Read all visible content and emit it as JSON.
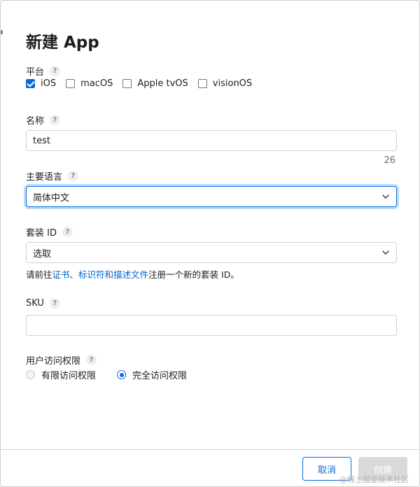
{
  "dialog": {
    "title": "新建 App"
  },
  "platform": {
    "label": "平台",
    "help": "?",
    "options": [
      {
        "label": "iOS",
        "checked": true
      },
      {
        "label": "macOS",
        "checked": false
      },
      {
        "label": "Apple tvOS",
        "checked": false
      },
      {
        "label": "visionOS",
        "checked": false
      }
    ]
  },
  "name": {
    "label": "名称",
    "help": "?",
    "value": "test",
    "remaining": "26"
  },
  "language": {
    "label": "主要语言",
    "help": "?",
    "selected": "简体中文"
  },
  "bundle": {
    "label": "套装 ID",
    "help": "?",
    "selected": "选取",
    "hint_prefix": "请前往",
    "hint_link": "证书、标识符和描述文件",
    "hint_suffix": "注册一个新的套装 ID。"
  },
  "sku": {
    "label": "SKU",
    "help": "?",
    "value": ""
  },
  "access": {
    "label": "用户访问权限",
    "help": "?",
    "options": [
      {
        "label": "有限访问权限",
        "selected": false
      },
      {
        "label": "完全访问权限",
        "selected": true
      }
    ]
  },
  "footer": {
    "cancel_label": "取消",
    "create_label": "创建"
  },
  "watermark": "@稀土掘金技术社区",
  "colors": {
    "accent": "#0b6bd6",
    "focus_ring": "#0071e3",
    "link": "#0066cc",
    "disabled_button": "#d9d9d9"
  }
}
